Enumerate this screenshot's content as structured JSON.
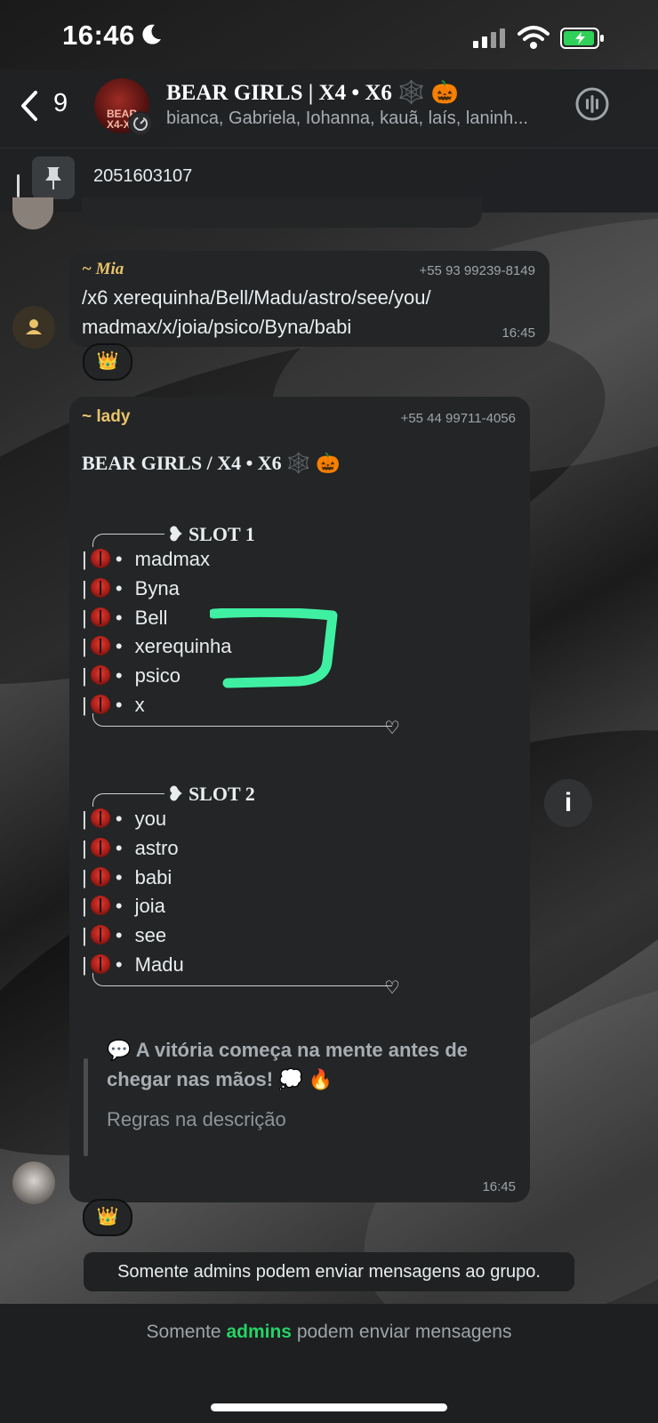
{
  "status_bar": {
    "time": "16:46"
  },
  "header": {
    "back_count": "9",
    "avatar_text": "BEAR X4-X",
    "title": "BEAR GIRLS | X4 • X6 🕸️ 🎃",
    "members": "bianca, Gabriela, Iohanna, kauã, laís, laninh..."
  },
  "pinned": {
    "text": "2051603107"
  },
  "messages": {
    "mia": {
      "sender": "~ Mia",
      "phone": "+55 93 99239-8149",
      "line1": "/x6 xerequinha/Bell/Madu/astro/see/you/",
      "line2": "madmax/x/joia/psico/Byna/babi",
      "time": "16:45",
      "reaction": "👑"
    },
    "lady": {
      "sender": "~ lady",
      "phone": "+55 44 99711-4056",
      "title": "BEAR GIRLS / X4 • X6 🕸️ 🎃",
      "slot1": {
        "header": "SLOT 1",
        "players": [
          "madmax",
          "Byna",
          "Bell",
          "xerequinha",
          "psico",
          "x"
        ]
      },
      "slot2": {
        "header": "SLOT 2",
        "players": [
          "you",
          "astro",
          "babi",
          "joia",
          "see",
          "Madu"
        ]
      },
      "quote_line1": "💬 A vitória começa na mente antes de",
      "quote_line2": "chegar nas mãos! 💭 🔥",
      "rules": "Regras na descrição",
      "time": "16:45",
      "reaction": "👑"
    }
  },
  "info_button": "i",
  "admin_notice": "Somente admins podem enviar mensagens ao grupo.",
  "bottom": {
    "pre": "Somente",
    "highlight": "admins",
    "post": "podem enviar mensagens"
  },
  "colors": {
    "accent_green": "#25d366",
    "annotation_green": "#3ff0a3",
    "mia_name": "#e8c36a",
    "lady_name": "#e8c36a"
  }
}
